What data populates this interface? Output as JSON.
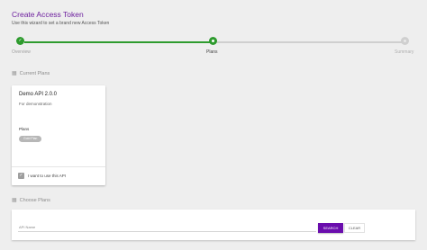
{
  "header": {
    "title": "Create Access Token",
    "subtitle": "Use this wizard to set a brand new Access Token"
  },
  "stepper": {
    "steps": [
      {
        "label": "Overview",
        "state": "done"
      },
      {
        "label": "Plans",
        "state": "current"
      },
      {
        "label": "Summary",
        "state": "todo"
      }
    ],
    "active_color": "#2e9b2e",
    "inactive_color": "#cfcfcf"
  },
  "current_plans": {
    "heading": "Current Plans",
    "card": {
      "title": "Demo API 2.0.0",
      "description": "For demonstration",
      "plans_label": "Plans",
      "chip": "Gold Plan",
      "checkbox_label": "I want to use this API",
      "checked": true
    }
  },
  "choose_plans": {
    "heading": "Choose Plans",
    "search": {
      "placeholder": "API Name",
      "value": ""
    },
    "search_button": "SEARCH",
    "clear_button": "CLEAR",
    "accent_color": "#6a0dad"
  }
}
